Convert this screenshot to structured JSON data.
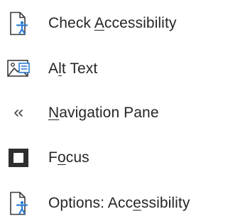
{
  "menu": {
    "items": [
      {
        "label_before": "Check ",
        "label_key": "A",
        "label_after": "ccessibility",
        "icon": "check-accessibility-icon"
      },
      {
        "label_before": "A",
        "label_key": "l",
        "label_after": "t Text",
        "icon": "alt-text-icon"
      },
      {
        "label_before": "",
        "label_key": "N",
        "label_after": "avigation Pane",
        "icon": "double-chevron-left-icon"
      },
      {
        "label_before": "F",
        "label_key": "o",
        "label_after": "cus",
        "icon": "focus-icon"
      },
      {
        "label_before": "Options: Acc",
        "label_key": "e",
        "label_after": "ssibility",
        "icon": "accessibility-options-icon"
      }
    ]
  },
  "colors": {
    "text": "#262626",
    "icon_dark": "#3b3b3b",
    "icon_accent": "#2b7cd3"
  }
}
